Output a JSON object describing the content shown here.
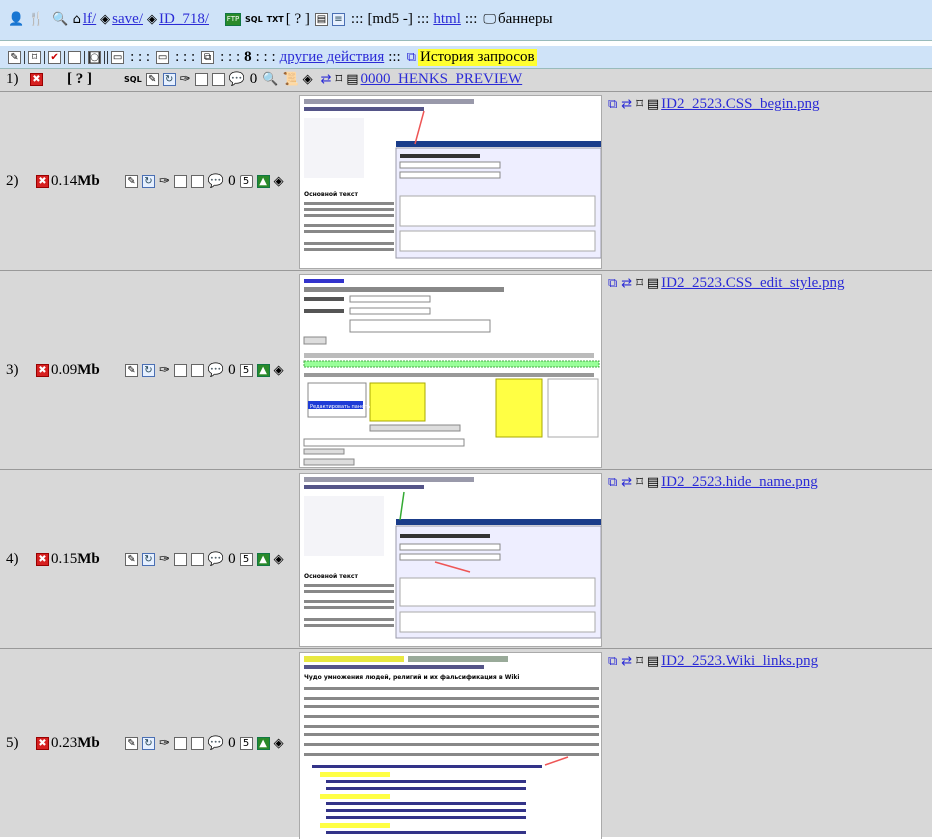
{
  "toolbar1": {
    "path_lf": "lf/",
    "path_save": "save/",
    "path_id": "ID_718/",
    "sql": "SQL",
    "txt": "TXT",
    "help": "[ ? ]",
    "sep": ":::",
    "md5": "[md5 -]",
    "html": "html",
    "banners": "баннеры"
  },
  "toolbar2": {
    "sep_a": "|",
    "sep_b": ": : :",
    "count": "8",
    "other_actions": "другие действия",
    "history": "История запросов"
  },
  "header_row": {
    "num": "1)",
    "help": "[ ? ]",
    "sql": "SQL",
    "zero": "0",
    "folder_name": "0000_HENKS_PREVIEW"
  },
  "rows": [
    {
      "num": "2)",
      "size_num": "0.14",
      "size_unit": "Mb",
      "zero": "0",
      "five": "5",
      "name": "ID2_2523.CSS_begin.png"
    },
    {
      "num": "3)",
      "size_num": "0.09",
      "size_unit": "Mb",
      "zero": "0",
      "five": "5",
      "name": "ID2_2523.CSS_edit_style.png"
    },
    {
      "num": "4)",
      "size_num": "0.15",
      "size_unit": "Mb",
      "zero": "0",
      "five": "5",
      "name": "ID2_2523.hide_name.png"
    },
    {
      "num": "5)",
      "size_num": "0.23",
      "size_unit": "Mb",
      "zero": "0",
      "five": "5",
      "name": "ID2_2523.Wiki_links.png"
    }
  ],
  "thumbs": {
    "t1_heading": "Основной текст",
    "t2_heading": "Редактировать панель",
    "t4_heading": "Основной текст",
    "t5_heading": "Чудо умножения людей, религий и их фальсификация в Wiki"
  },
  "colors": {
    "toolbar_bg": "#cfe3f8",
    "row_bg": "#d8d8d8",
    "link": "#2b2bd6",
    "highlight": "#ffff30",
    "delete_red": "#d62020"
  }
}
